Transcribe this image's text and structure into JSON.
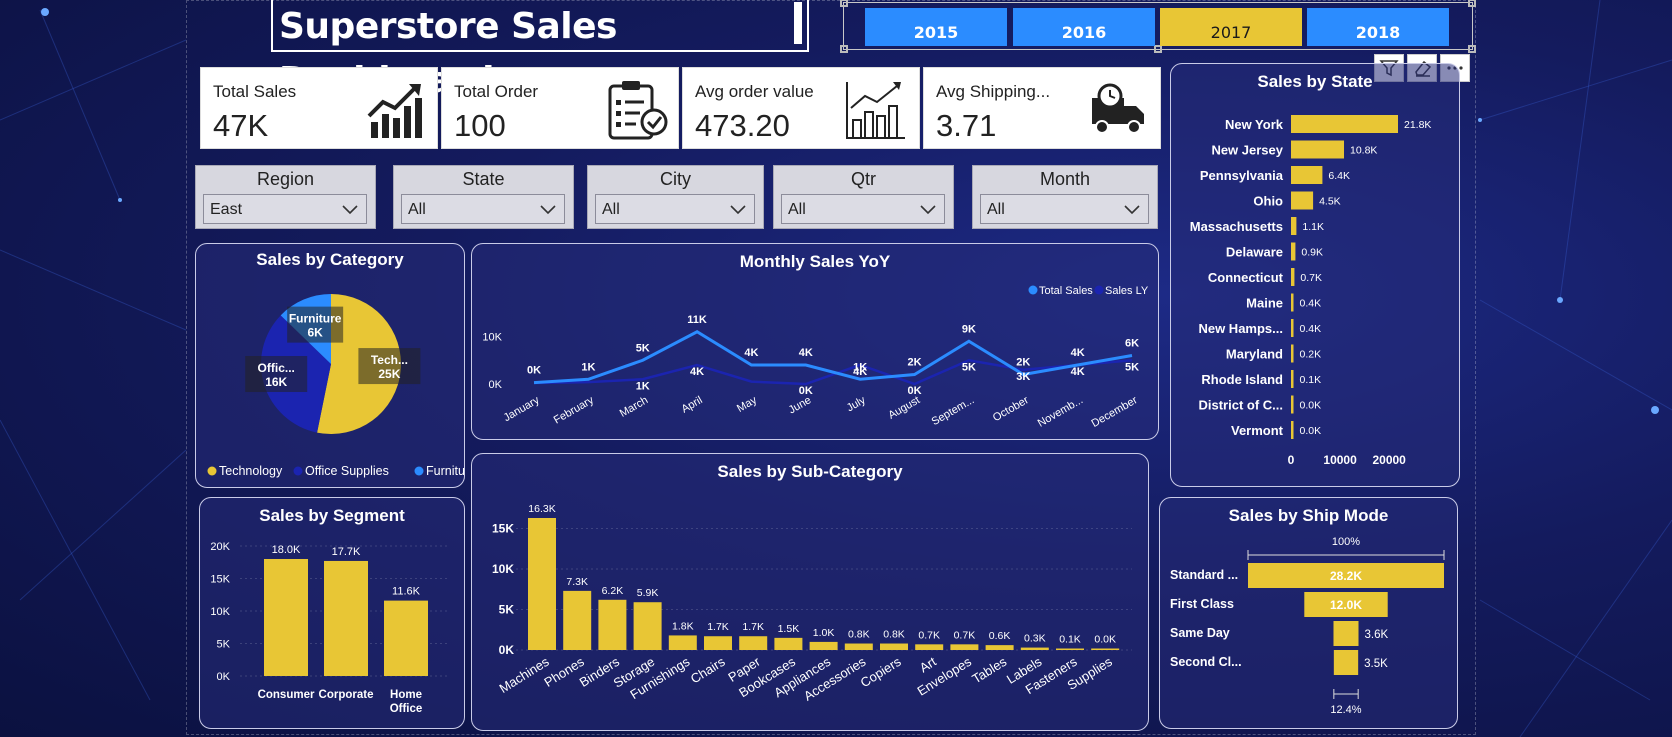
{
  "dashboard": {
    "title": "Superstore Sales Dashboard",
    "years": [
      "2015",
      "2016",
      "2017",
      "2018"
    ],
    "selected_year": "2017"
  },
  "kpis": [
    {
      "label": "Total Sales",
      "value": "47K",
      "icon": "trend-chart-icon"
    },
    {
      "label": "Total Order",
      "value": "100",
      "icon": "clipboard-check-icon"
    },
    {
      "label": "Avg order value",
      "value": "473.20",
      "icon": "bar-chart-growth-icon"
    },
    {
      "label": "Avg Shipping...",
      "value": "3.71",
      "icon": "delivery-truck-clock-icon"
    }
  ],
  "slicers": [
    {
      "title": "Region",
      "value": "East"
    },
    {
      "title": "State",
      "value": "All"
    },
    {
      "title": "City",
      "value": "All"
    },
    {
      "title": "Qtr",
      "value": "All"
    },
    {
      "title": "Month",
      "value": "All"
    }
  ],
  "colors": {
    "gold": "#e8c635",
    "blue": "#2b8cff",
    "navy": "#1b24b0"
  },
  "chart_data": [
    {
      "id": "category",
      "type": "pie",
      "title": "Sales by Category",
      "slices": [
        {
          "name": "Technology",
          "label": "Tech...",
          "value_label": "25K",
          "value": 25
        },
        {
          "name": "Office Supplies",
          "label": "Offic...",
          "value_label": "16K",
          "value": 16
        },
        {
          "name": "Furniture",
          "label": "Furniture",
          "value_label": "6K",
          "value": 6
        }
      ],
      "legend": [
        "Technology",
        "Office Supplies",
        "Furniture"
      ],
      "legend_position": "bottom"
    },
    {
      "id": "monthly",
      "type": "line",
      "title": "Monthly Sales YoY",
      "categories": [
        "January",
        "February",
        "March",
        "April",
        "May",
        "June",
        "July",
        "August",
        "Septem...",
        "October",
        "Novemb...",
        "December"
      ],
      "series": [
        {
          "name": "Total Sales",
          "values": [
            0.3,
            1,
            5,
            11,
            4,
            4,
            1,
            2,
            9,
            2,
            4,
            6
          ],
          "labels": [
            "0K",
            "1K",
            "5K",
            "11K",
            "4K",
            "4K",
            "1K",
            "2K",
            "9K",
            "2K",
            "4K",
            "6K"
          ]
        },
        {
          "name": "Sales LY",
          "values": [
            0.2,
            0.4,
            1,
            4,
            0.5,
            0,
            4,
            0,
            5,
            3,
            4,
            5
          ],
          "labels": [
            "",
            "",
            "1K",
            "4K",
            "",
            "0K",
            "4K",
            "0K",
            "5K",
            "3K",
            "4K",
            "5K"
          ]
        }
      ],
      "y_ticks": [
        "0K",
        "10K"
      ],
      "ylim": [
        0,
        12
      ],
      "legend_position": "top-right"
    },
    {
      "id": "state",
      "type": "bar",
      "orientation": "horizontal",
      "title": "Sales by State",
      "categories": [
        "New York",
        "New Jersey",
        "Pennsylvania",
        "Ohio",
        "Massachusetts",
        "Delaware",
        "Connecticut",
        "Maine",
        "New Hamps...",
        "Maryland",
        "Rhode Island",
        "District of C...",
        "Vermont"
      ],
      "values": [
        21.8,
        10.8,
        6.4,
        4.5,
        1.1,
        0.9,
        0.7,
        0.4,
        0.4,
        0.2,
        0.1,
        0.0,
        0.0
      ],
      "value_labels": [
        "21.8K",
        "10.8K",
        "6.4K",
        "4.5K",
        "1.1K",
        "0.9K",
        "0.7K",
        "0.4K",
        "0.4K",
        "0.2K",
        "0.1K",
        "0.0K",
        "0.0K"
      ],
      "x_ticks": [
        "0",
        "10000",
        "20000"
      ],
      "xlim": [
        0,
        24
      ]
    },
    {
      "id": "segment",
      "type": "bar",
      "title": "Sales by Segment",
      "categories": [
        "Consumer",
        "Corporate",
        "Home Office"
      ],
      "values": [
        18.0,
        17.7,
        11.6
      ],
      "value_labels": [
        "18.0K",
        "17.7K",
        "11.6K"
      ],
      "y_ticks": [
        "0K",
        "5K",
        "10K",
        "15K",
        "20K"
      ],
      "ylim": [
        0,
        20
      ]
    },
    {
      "id": "subcategory",
      "type": "bar",
      "title": "Sales by Sub-Category",
      "categories": [
        "Machines",
        "Phones",
        "Binders",
        "Storage",
        "Furnishings",
        "Chairs",
        "Paper",
        "Bookcases",
        "Appliances",
        "Accessories",
        "Copiers",
        "Art",
        "Envelopes",
        "Tables",
        "Labels",
        "Fasteners",
        "Supplies"
      ],
      "values": [
        16.3,
        7.3,
        6.2,
        5.9,
        1.8,
        1.7,
        1.7,
        1.5,
        1.0,
        0.8,
        0.8,
        0.7,
        0.7,
        0.6,
        0.3,
        0.1,
        0.0
      ],
      "value_labels": [
        "16.3K",
        "7.3K",
        "6.2K",
        "5.9K",
        "1.8K",
        "1.7K",
        "1.7K",
        "1.5K",
        "1.0K",
        "0.8K",
        "0.8K",
        "0.7K",
        "0.7K",
        "0.6K",
        "0.3K",
        "0.1K",
        "0.0K"
      ],
      "y_ticks": [
        "0K",
        "5K",
        "10K",
        "15K"
      ],
      "ylim": [
        0,
        17
      ]
    },
    {
      "id": "shipmode",
      "type": "bar",
      "orientation": "funnel",
      "title": "Sales by Ship Mode",
      "categories": [
        "Standard ...",
        "First Class",
        "Same Day",
        "Second Cl..."
      ],
      "values": [
        28.2,
        12.0,
        3.6,
        3.5
      ],
      "value_labels": [
        "28.2K",
        "12.0K",
        "3.6K",
        "3.5K"
      ],
      "top_label": "100%",
      "bottom_label": "12.4%"
    }
  ]
}
